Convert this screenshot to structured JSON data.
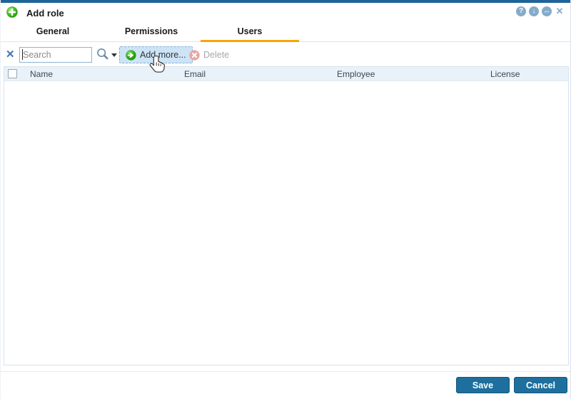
{
  "window": {
    "title": "Add role",
    "controls": {
      "help": "?",
      "collapse": "↓",
      "resize": "↔",
      "close": "✕"
    }
  },
  "tabs": [
    {
      "label": "General",
      "active": false
    },
    {
      "label": "Permissions",
      "active": false
    },
    {
      "label": "Users",
      "active": true
    }
  ],
  "toolbar": {
    "clear_icon": "✕",
    "search": {
      "value": "",
      "placeholder": "Search"
    },
    "add_more_label": "Add more...",
    "delete_label": "Delete",
    "delete_enabled": false
  },
  "table": {
    "columns": [
      "Name",
      "Email",
      "Employee",
      "License"
    ],
    "rows": []
  },
  "footer": {
    "save_label": "Save",
    "cancel_label": "Cancel"
  },
  "colors": {
    "titlebar_strip": "#1e6498",
    "active_tab_underline": "#f7a600",
    "primary_button": "#1d6f9e",
    "add_more_hover_bg": "#cde4f6",
    "table_header_bg": "#e9f2f9",
    "add_icon_green": "#2fa814",
    "delete_icon_red": "#e9a6a4",
    "window_control_blue": "#84abc9"
  }
}
